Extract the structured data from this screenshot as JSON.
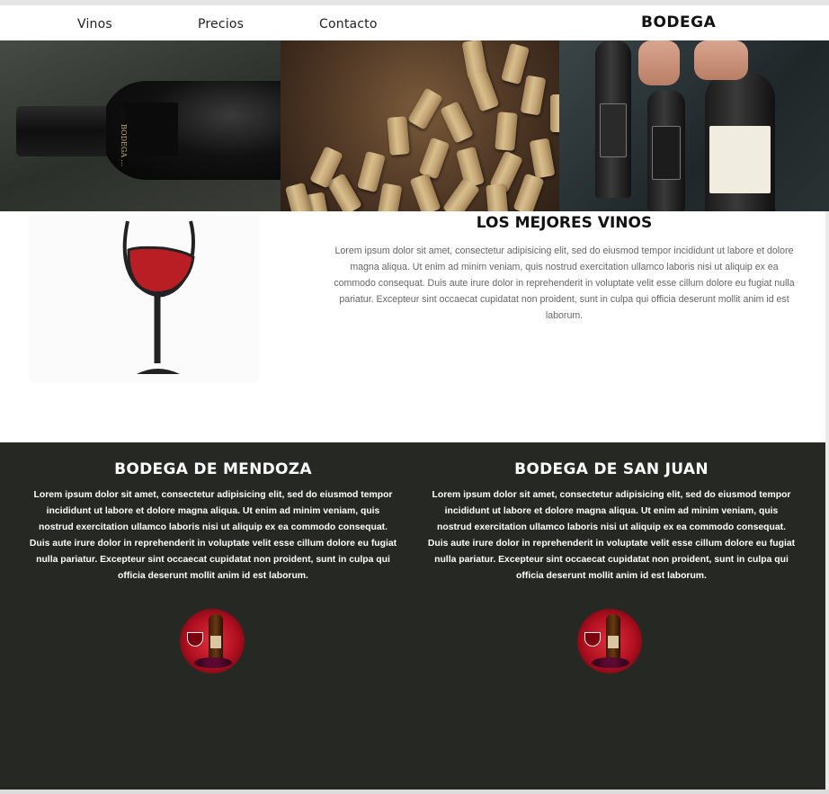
{
  "nav": {
    "links": [
      "Vinos",
      "Precios",
      "Contacto"
    ],
    "brand": "BODEGA"
  },
  "hero": {
    "bottle_label": "BODEGA ..."
  },
  "intro": {
    "title": "LOS MEJORES VINOS",
    "text": "Lorem ipsum dolor sit amet, consectetur adipisicing elit, sed do eiusmod tempor incididunt ut labore et dolore magna aliqua. Ut enim ad minim veniam, quis nostrud exercitation ullamco laboris nisi ut aliquip ex ea commodo consequat. Duis aute irure dolor in reprehenderit in voluptate velit esse cillum dolore eu fugiat nulla pariatur. Excepteur sint occaecat cupidatat non proident, sunt in culpa qui officia deserunt mollit anim id est laborum."
  },
  "sections": [
    {
      "title": "BODEGA DE MENDOZA",
      "text": "Lorem ipsum dolor sit amet, consectetur adipisicing elit, sed do eiusmod tempor incididunt ut labore et dolore magna aliqua. Ut enim ad minim veniam, quis nostrud exercitation ullamco laboris nisi ut aliquip ex ea commodo consequat. Duis aute irure dolor in reprehenderit in voluptate velit esse cillum dolore eu fugiat nulla pariatur. Excepteur sint occaecat cupidatat non proident, sunt in culpa qui officia deserunt mollit anim id est laborum."
    },
    {
      "title": "BODEGA DE SAN JUAN",
      "text": "Lorem ipsum dolor sit amet, consectetur adipisicing elit, sed do eiusmod tempor incididunt ut labore et dolore magna aliqua. Ut enim ad minim veniam, quis nostrud exercitation ullamco laboris nisi ut aliquip ex ea commodo consequat. Duis aute irure dolor in reprehenderit in voluptate velit esse cillum dolore eu fugiat nulla pariatur. Excepteur sint occaecat cupidatat non proident, sunt in culpa qui officia deserunt mollit anim id est laborum."
    }
  ],
  "colors": {
    "dark_section": "#262823",
    "wine_red": "#b01020"
  }
}
